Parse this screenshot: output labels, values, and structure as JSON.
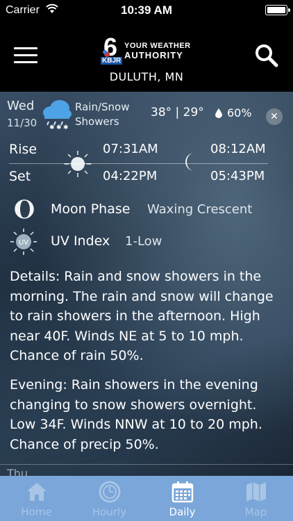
{
  "status_bar": {
    "carrier": "Carrier",
    "time": "10:39 AM"
  },
  "header": {
    "logo_line1": "YOUR WEATHER",
    "logo_line2": "AUTHORITY",
    "logo_badge": "KBJR",
    "location": "DULUTH, MN"
  },
  "day": {
    "name": "Wed",
    "date": "11/30",
    "condition_line1": "Rain/Snow",
    "condition_line2": "Showers",
    "temps": "38° | 29°",
    "precip": "60%"
  },
  "sun_moon": {
    "rise_label": "Rise",
    "set_label": "Set",
    "sunrise": "07:31AM",
    "sunset": "04:22PM",
    "moonrise": "08:12AM",
    "moonset": "05:43PM"
  },
  "moon_phase": {
    "label": "Moon Phase",
    "value": "Waxing Crescent"
  },
  "uv": {
    "icon_text": "UV",
    "label": "UV Index",
    "value": "1-Low"
  },
  "details": "Details: Rain and snow showers in the morning. The rain and snow will change to rain showers in the afternoon. High near 40F. Winds NE at 5 to 10 mph. Chance of rain 50%.",
  "evening": "Evening: Rain showers in the evening changing to snow showers overnight. Low 34F. Winds NNW at 10 to 20 mph. Chance of precip 50%.",
  "next_day_peek": "Thu",
  "tabs": [
    {
      "label": "Home",
      "icon": "home-icon"
    },
    {
      "label": "Hourly",
      "icon": "clock-icon"
    },
    {
      "label": "Daily",
      "icon": "calendar-icon",
      "active": true
    },
    {
      "label": "Map",
      "icon": "map-icon"
    }
  ],
  "colors": {
    "tabbar": "#7aa6d9",
    "tab_inactive": "#a9c5e6",
    "tab_active": "#ffffff"
  }
}
